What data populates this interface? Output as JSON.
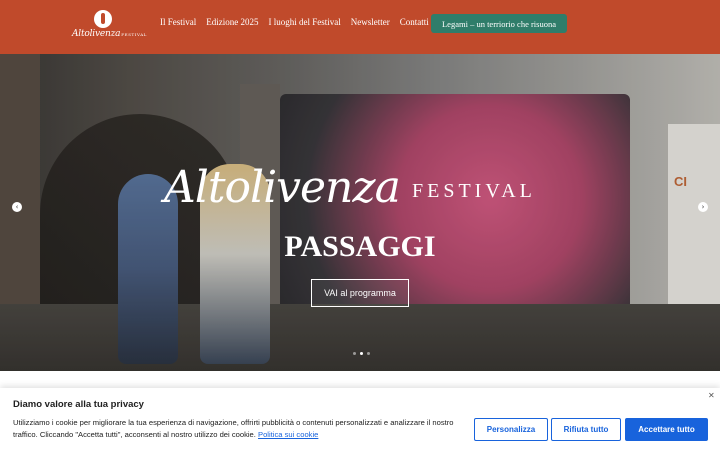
{
  "header": {
    "logo_text": "Altolivenza",
    "logo_sub": "FESTIVAL",
    "nav": [
      {
        "label": "Il Festival"
      },
      {
        "label": "Edizione 2025"
      },
      {
        "label": "I luoghi del Festival"
      },
      {
        "label": "Newsletter"
      },
      {
        "label": "Contatti"
      }
    ],
    "cta_label": "Legami – un terriorio che risuona"
  },
  "hero": {
    "logo_script": "Altolivenza",
    "logo_caps": "FESTIVAL",
    "title": "PASSAGGI",
    "button_label": "VAI al programma",
    "prev_icon": "chevron-left-icon",
    "next_icon": "chevron-right-icon",
    "poster_text": "CI",
    "slide_count": 3,
    "active_slide": 2
  },
  "cookie": {
    "title": "Diamo valore alla tua privacy",
    "text": "Utilizziamo i cookie per migliorare la tua esperienza di navigazione, offrirti pubblicità o contenuti personalizzati e analizzare il nostro traffico. Cliccando \"Accetta tutti\", acconsenti al nostro utilizzo dei cookie.",
    "link_label": "Politica sui cookie",
    "close_icon": "close-icon",
    "buttons": {
      "customize": "Personalizza",
      "reject": "Rifiuta tutto",
      "accept": "Accettare tutto"
    }
  },
  "colors": {
    "header_bg": "#c04a2b",
    "cta_bg": "#2f7d6a",
    "cookie_accent": "#1863dc"
  }
}
